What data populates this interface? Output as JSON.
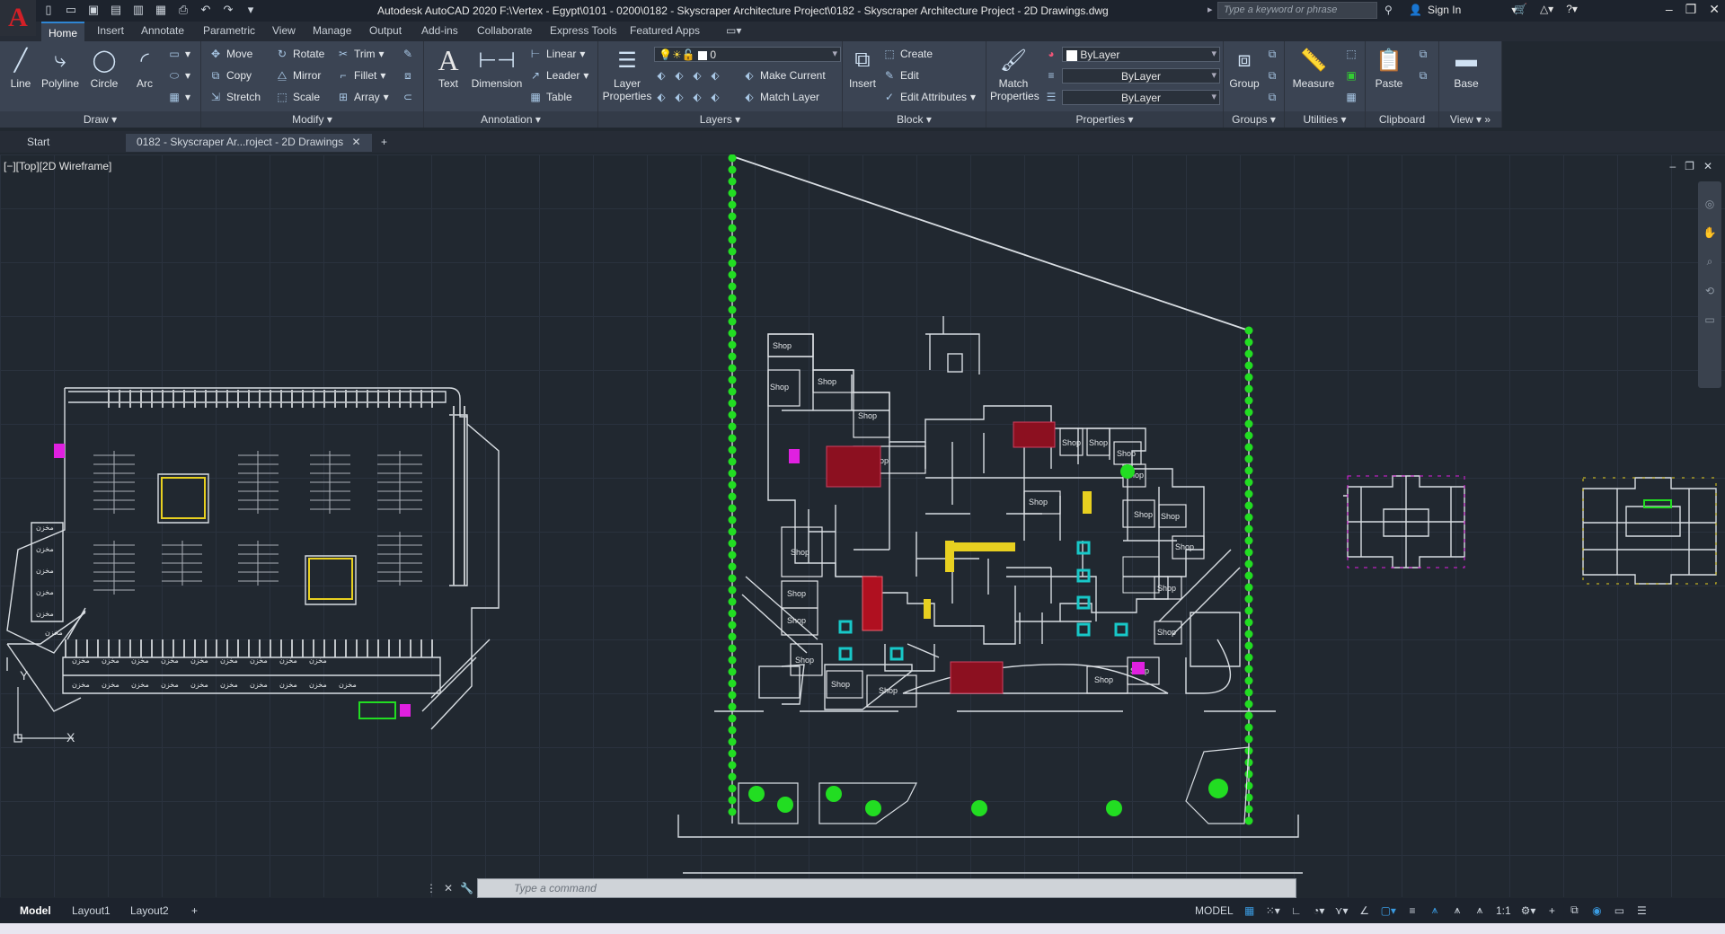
{
  "app": {
    "logo_letter": "A",
    "title": "Autodesk AutoCAD 2020    F:\\Vertex - Egypt\\0101 - 0200\\0182 - Skyscraper Architecture Project\\0182 - Skyscraper Architecture Project - 2D Drawings.dwg",
    "search_placeholder": "Type a keyword or phrase",
    "sign_in": "Sign In"
  },
  "ribbon_tabs": [
    "Home",
    "Insert",
    "Annotate",
    "Parametric",
    "View",
    "Manage",
    "Output",
    "Add-ins",
    "Collaborate",
    "Express Tools",
    "Featured Apps"
  ],
  "ribbon": {
    "draw": {
      "title": "Draw",
      "line": "Line",
      "polyline": "Polyline",
      "circle": "Circle",
      "arc": "Arc"
    },
    "modify": {
      "title": "Modify",
      "move": "Move",
      "rotate": "Rotate",
      "trim": "Trim",
      "copy": "Copy",
      "mirror": "Mirror",
      "fillet": "Fillet",
      "stretch": "Stretch",
      "scale": "Scale",
      "array": "Array"
    },
    "annotation": {
      "title": "Annotation",
      "text": "Text",
      "dimension": "Dimension",
      "linear": "Linear",
      "leader": "Leader",
      "table": "Table"
    },
    "layers": {
      "title": "Layers",
      "layer_properties": "Layer Properties",
      "current_layer": "0",
      "make_current": "Make Current",
      "match_layer": "Match Layer"
    },
    "insert": {
      "label": "Insert"
    },
    "block": {
      "title": "Block",
      "create": "Create",
      "edit": "Edit",
      "edit_attributes": "Edit Attributes"
    },
    "properties": {
      "title": "Properties",
      "match_properties": "Match Properties",
      "color": "ByLayer",
      "linetype": "ByLayer",
      "lineweight": "ByLayer"
    },
    "groups": {
      "title": "Groups",
      "group": "Group"
    },
    "utilities": {
      "title": "Utilities",
      "measure": "Measure"
    },
    "clipboard": {
      "title": "Clipboard",
      "paste": "Paste"
    },
    "view": {
      "title": "View",
      "base": "Base"
    }
  },
  "doc_tabs": {
    "start": "Start",
    "active": "0182 - Skyscraper Ar...roject - 2D Drawings"
  },
  "viewport": {
    "label": "[−][Top][2D Wireframe]"
  },
  "drawing_labels": {
    "shop": "Shop",
    "store": "مخزن",
    "ucs_x": "X",
    "ucs_y": "Y"
  },
  "command": {
    "placeholder": "Type a command"
  },
  "layout_tabs": [
    "Model",
    "Layout1",
    "Layout2"
  ],
  "status": {
    "model": "MODEL",
    "scale": "1:1"
  },
  "colors": {
    "accent": "#2f86d4",
    "plant": "#22dd22",
    "magenta": "#e020e0",
    "cyan": "#18c8c8",
    "yellow": "#e8d020",
    "red": "#8c1020"
  }
}
